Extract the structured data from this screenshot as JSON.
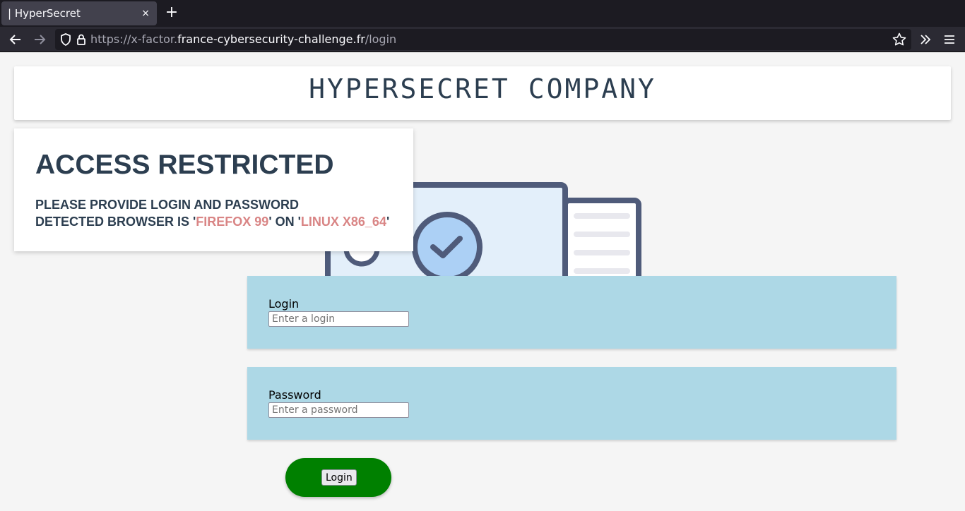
{
  "browser": {
    "tab_title": "| HyperSecret",
    "tab_close": "×",
    "new_tab": "+",
    "url_scheme": "https://x-factor.",
    "url_domain": "france-cybersecurity-challenge.fr",
    "url_path": "/login"
  },
  "header": {
    "company_name": "HYPERSECRET COMPANY"
  },
  "access": {
    "title": "ACCESS RESTRICTED",
    "line1": "PLEASE PROVIDE LOGIN AND PASSWORD",
    "line2_prefix": "DETECTED BROWSER IS '",
    "browser_name": "FIREFOX 99",
    "line2_mid": "' ON '",
    "os_name": "LINUX X86_64",
    "line2_suffix": "'"
  },
  "form": {
    "login_label": "Login",
    "login_placeholder": "Enter a login",
    "login_value": "",
    "password_label": "Password",
    "password_placeholder": "Enter a password",
    "password_value": "",
    "submit_label": "Login"
  },
  "colors": {
    "heading": "#2c3e50",
    "highlight": "#d98585",
    "field_bg": "#add8e6",
    "submit_pill": "#008000"
  }
}
